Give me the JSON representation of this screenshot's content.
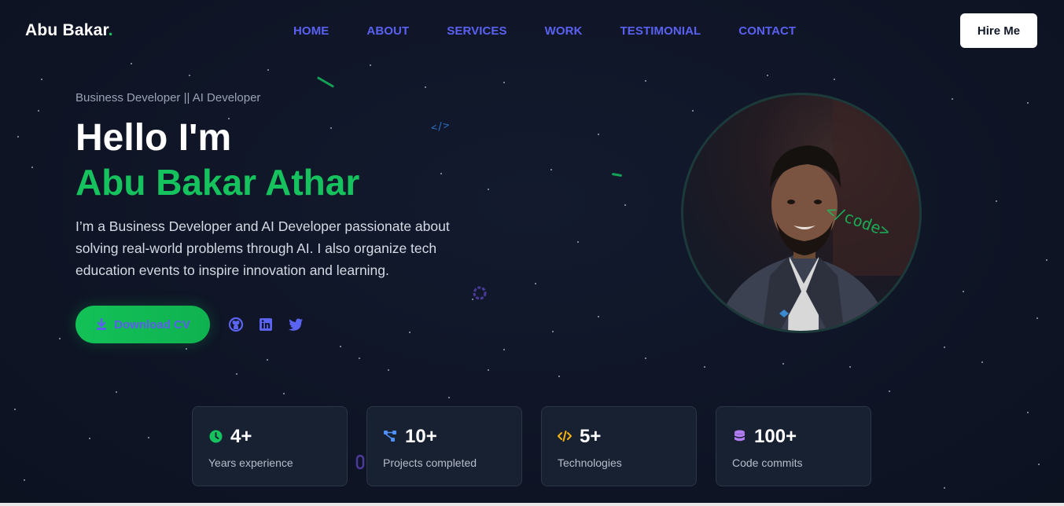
{
  "header": {
    "logo_text": "Abu Bakar",
    "logo_dot": ".",
    "nav": [
      "HOME",
      "ABOUT",
      "SERVICES",
      "WORK",
      "TESTIMONIAL",
      "CONTACT"
    ],
    "hire_label": "Hire Me"
  },
  "hero": {
    "subtitle": "Business Developer || AI Developer",
    "greeting": "Hello I'm",
    "name": "Abu Bakar Athar",
    "description": "I’m a Business Developer and AI Developer passionate about solving real-world problems through AI. I also organize tech education events to inspire innovation and learning.",
    "cv_label": "Download CV",
    "socials": [
      "github-icon",
      "linkedin-icon",
      "twitter-icon"
    ]
  },
  "decorations": {
    "code_tag": "</>",
    "avatar_overlay": "</code>"
  },
  "stats": [
    {
      "value": "4+",
      "label": "Years experience",
      "icon": "clock-icon",
      "color": "#16c25e"
    },
    {
      "value": "10+",
      "label": "Projects completed",
      "icon": "network-icon",
      "color": "#4f8ff7"
    },
    {
      "value": "5+",
      "label": "Technologies",
      "icon": "code-icon",
      "color": "#f5b40b"
    },
    {
      "value": "100+",
      "label": "Code commits",
      "icon": "database-icon",
      "color": "#b27cf2"
    }
  ],
  "colors": {
    "background": "#0f1527",
    "accent_green": "#16c25e",
    "nav_blue": "#5a61f2"
  }
}
